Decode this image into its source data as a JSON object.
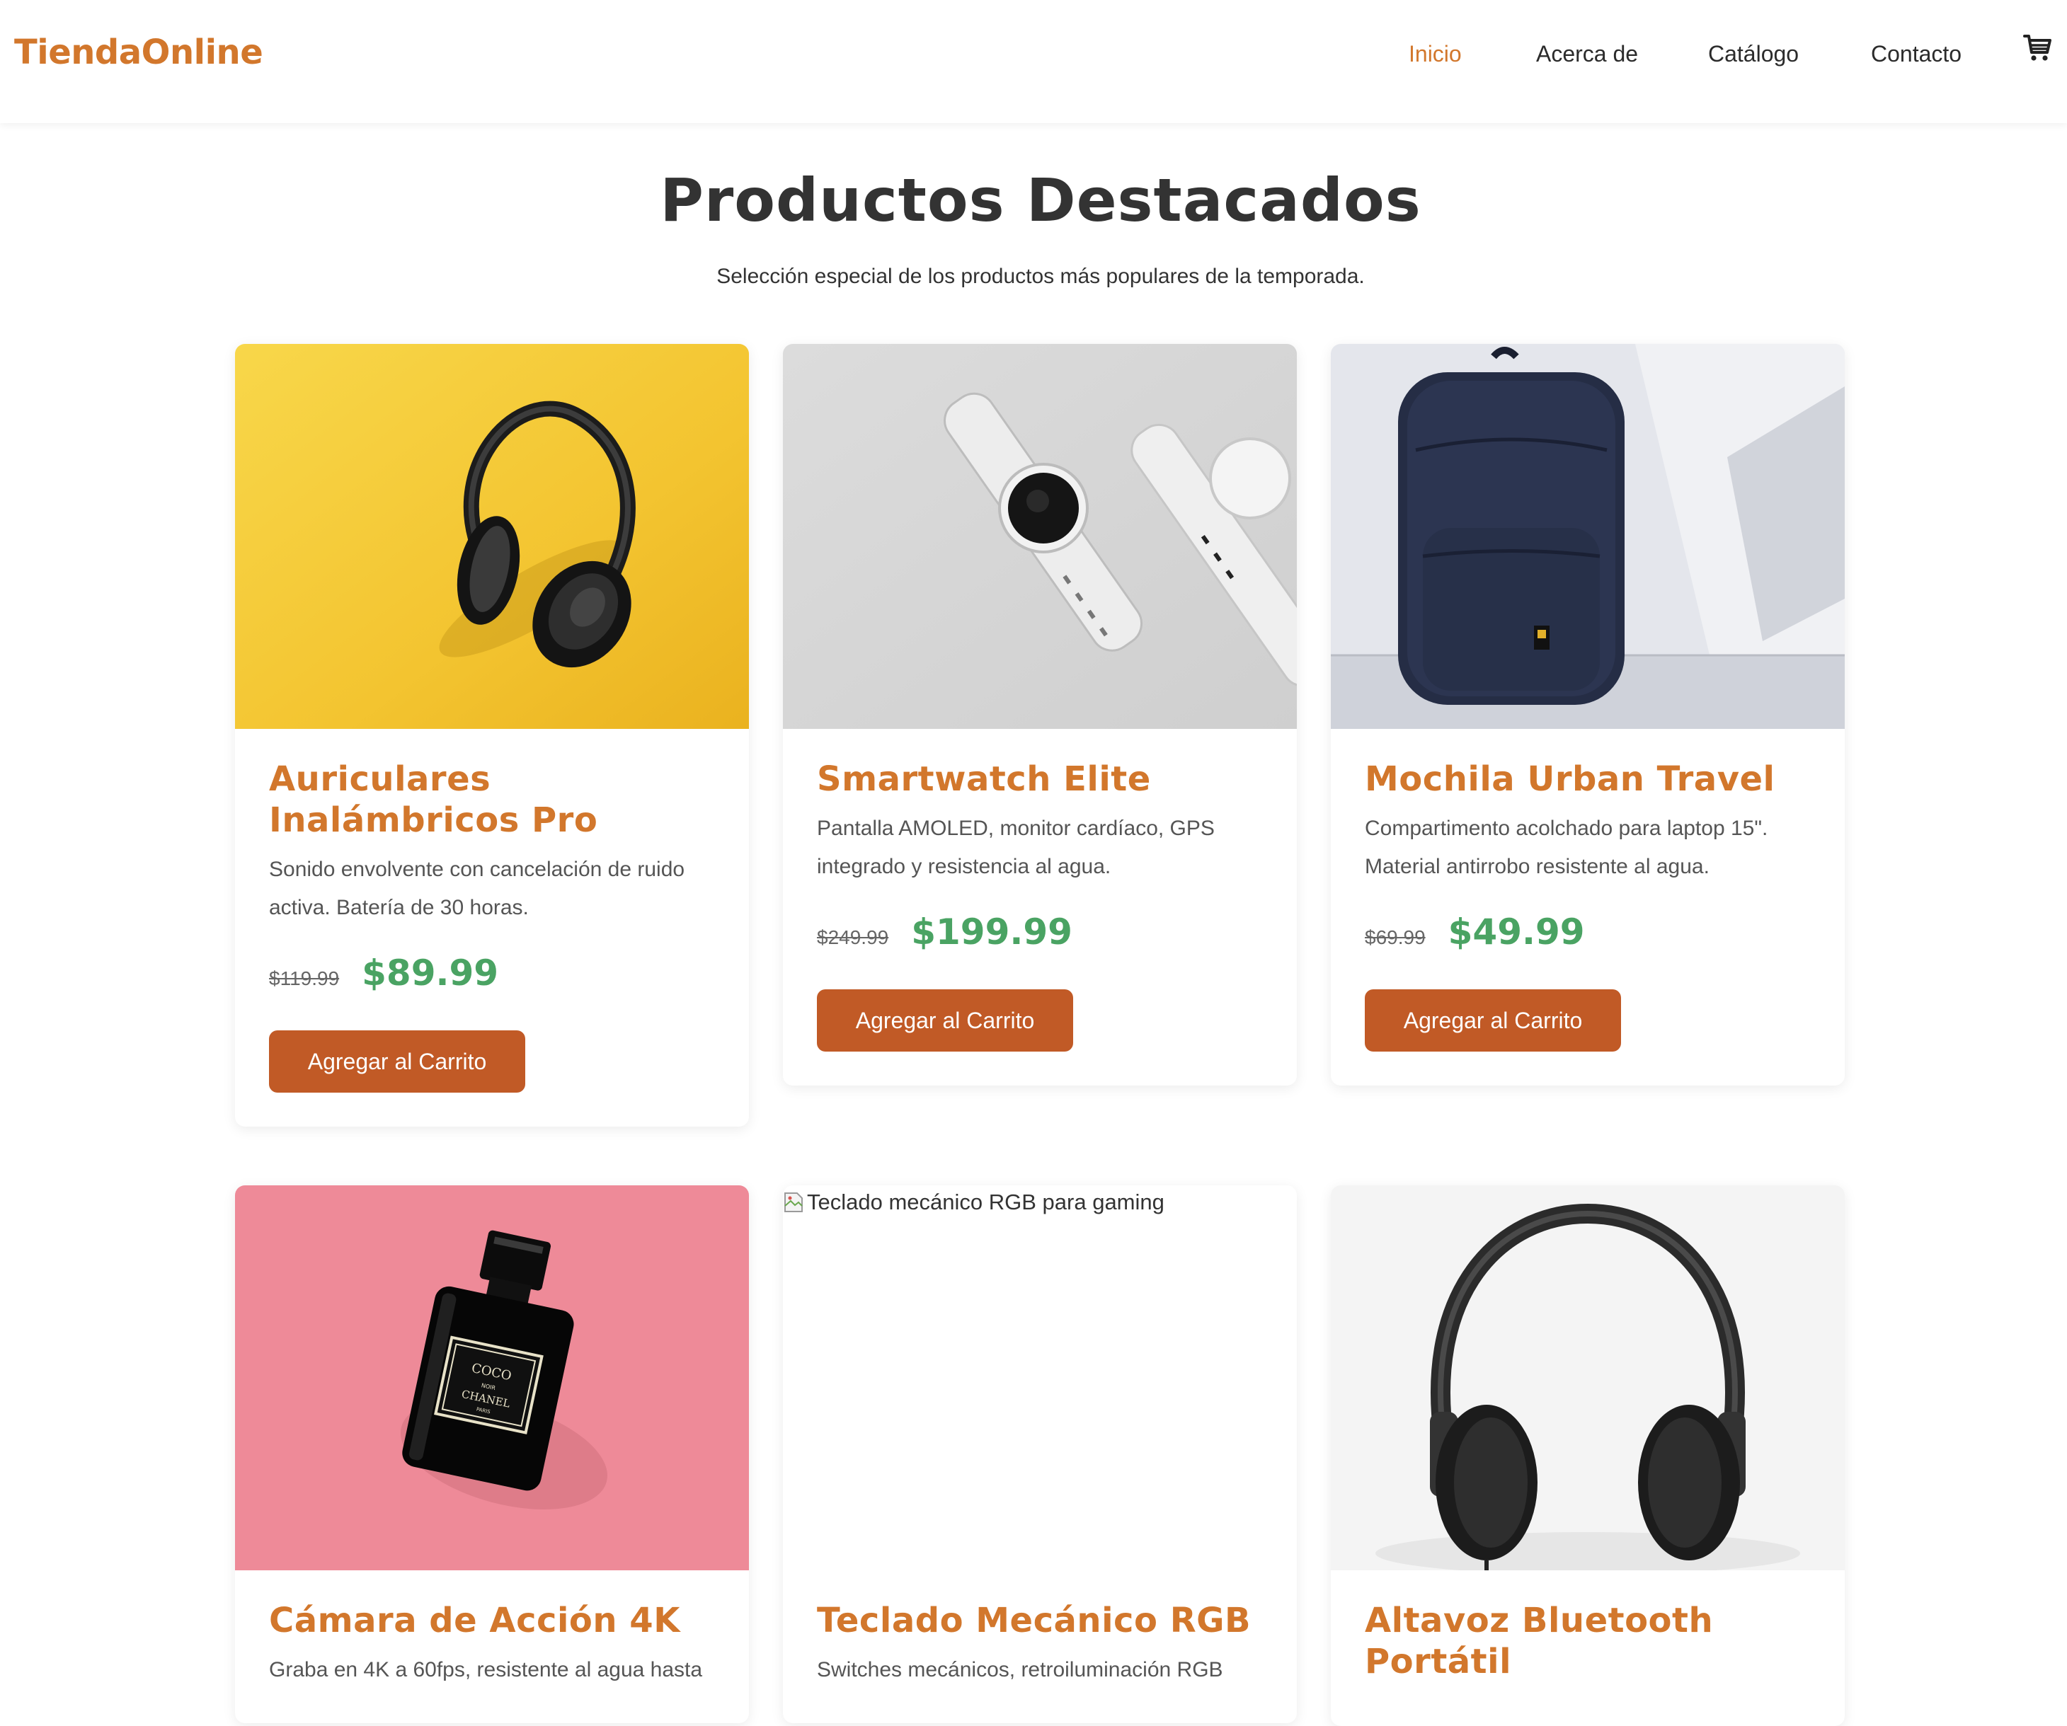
{
  "brand": {
    "name": "TiendaOnline",
    "accent_color": "#d2772c"
  },
  "nav": {
    "items": [
      {
        "label": "Inicio",
        "active": true
      },
      {
        "label": "Acerca de",
        "active": false
      },
      {
        "label": "Catálogo",
        "active": false
      },
      {
        "label": "Contacto",
        "active": false
      }
    ],
    "cart_icon": "shopping-cart-icon"
  },
  "hero": {
    "title": "Productos Destacados",
    "subtitle": "Selección especial de los productos más populares de la temporada."
  },
  "colors": {
    "title": "#d2772c",
    "price": "#4aa363",
    "button": "#c15a26"
  },
  "products": [
    {
      "name": "Auriculares Inalámbricos Pro",
      "description": "Sonido envolvente con cancelación de ruido activa. Batería de 30 horas.",
      "old_price": "$119.99",
      "price": "$89.99",
      "button": "Agregar al Carrito",
      "image": "headphones-on-yellow"
    },
    {
      "name": "Smartwatch Elite",
      "description": "Pantalla AMOLED, monitor cardíaco, GPS integrado y resistencia al agua.",
      "old_price": "$249.99",
      "price": "$199.99",
      "button": "Agregar al Carrito",
      "image": "smartwatches-on-gray"
    },
    {
      "name": "Mochila Urban Travel",
      "description": "Compartimento acolchado para laptop 15\". Material antirrobo resistente al agua.",
      "old_price": "$69.99",
      "price": "$49.99",
      "button": "Agregar al Carrito",
      "image": "navy-backpack"
    },
    {
      "name": "Cámara de Acción 4K",
      "description": "Graba en 4K a 60fps, resistente al agua hasta",
      "image": "perfume-bottle-on-pink",
      "image_label": [
        "COCO",
        "NOIR",
        "CHANEL",
        "PARIS"
      ]
    },
    {
      "name": "Teclado Mecánico RGB",
      "description": "Switches mecánicos, retroiluminación RGB",
      "image": "broken-image",
      "image_alt": "Teclado mecánico RGB para gaming"
    },
    {
      "name": "Altavoz Bluetooth Portátil",
      "description": "",
      "image": "black-headphones-on-white"
    }
  ]
}
